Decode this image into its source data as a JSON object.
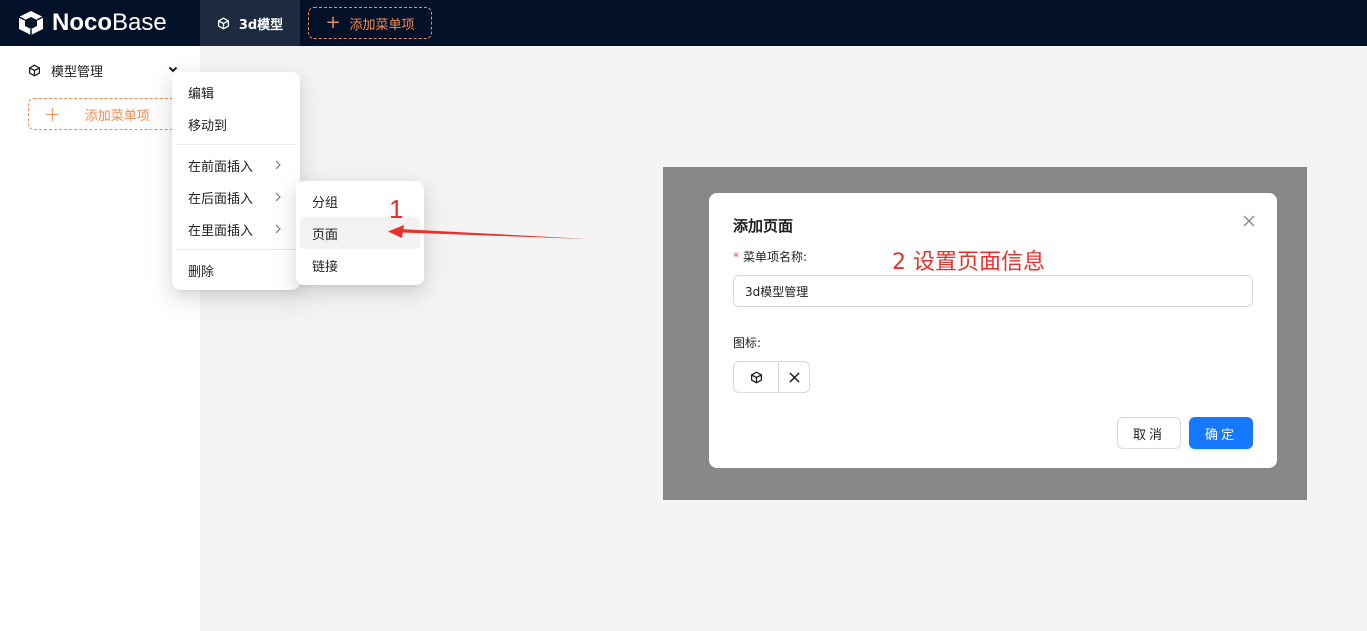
{
  "app": {
    "logo_bold": "Noco",
    "logo_light": "Base"
  },
  "topbar": {
    "active_tab": {
      "label": "3d模型",
      "icon": "cube-icon"
    },
    "add_menu_label": "添加菜单项"
  },
  "sidebar": {
    "items": [
      {
        "label": "模型管理",
        "icon": "cube-icon",
        "expanded": true
      }
    ],
    "add_menu_label": "添加菜单项"
  },
  "context_menu": {
    "items": [
      {
        "label": "编辑"
      },
      {
        "label": "移动到"
      },
      {
        "label": "在前面插入",
        "has_submenu": true
      },
      {
        "label": "在后面插入",
        "has_submenu": true
      },
      {
        "label": "在里面插入",
        "has_submenu": true,
        "open": true
      },
      {
        "label": "删除"
      }
    ]
  },
  "submenu": {
    "items": [
      {
        "label": "分组"
      },
      {
        "label": "页面",
        "highlighted": true
      },
      {
        "label": "链接"
      }
    ]
  },
  "annotations": {
    "step1": "1",
    "step2": "2 设置页面信息",
    "color": "#e8312a"
  },
  "modal": {
    "title": "添加页面",
    "name_label": "菜单项名称:",
    "name_required_mark": "*",
    "name_value": "3d模型管理",
    "icon_label": "图标:",
    "selected_icon": "cube-icon",
    "cancel_label": "取消",
    "ok_label": "确定"
  },
  "colors": {
    "topbar_bg": "#031128",
    "accent_orange": "#f18b4e",
    "primary": "#1677ff",
    "overlay": "#888888"
  }
}
